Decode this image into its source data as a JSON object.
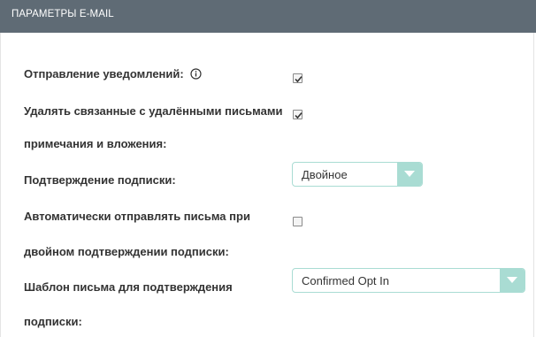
{
  "header": {
    "title": "ПАРАМЕТРЫ E-MAIL"
  },
  "fields": {
    "send_notifications": {
      "label": "Отправление уведомлений:",
      "icon": "info-icon",
      "checked": true
    },
    "delete_related": {
      "label_line1": "Удалять связанные с удалёнными письмами",
      "label_line2": "примечания и вложения:",
      "checked": true
    },
    "subscription_confirm": {
      "label": "Подтверждение подписки:",
      "selected": "Двойное"
    },
    "auto_send": {
      "label_line1": "Автоматически отправлять письма при",
      "label_line2": "двойном подтверждении подписки:",
      "checked": false
    },
    "confirm_template": {
      "label_line1": "Шаблон письма для подтверждения",
      "label_line2": "подписки:",
      "selected": "Confirmed Opt In"
    }
  },
  "colors": {
    "header_bg": "#5f6b75",
    "select_accent": "#a9dcd3",
    "label_text": "#333333"
  }
}
